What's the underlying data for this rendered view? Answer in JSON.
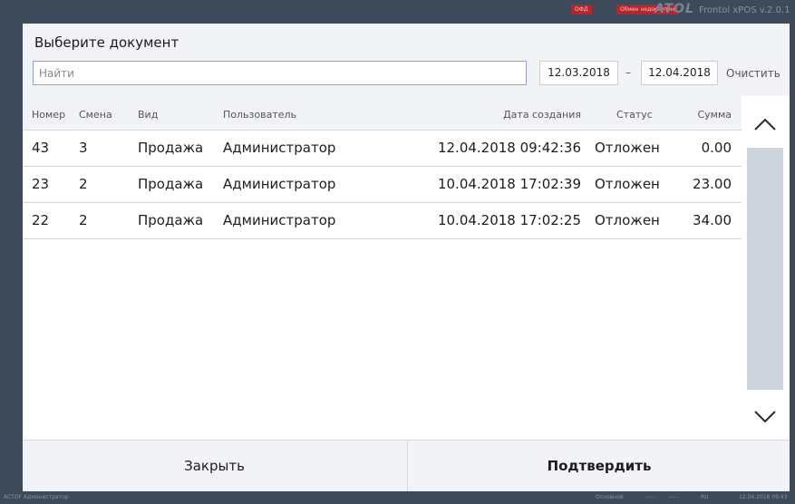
{
  "topbar": {
    "ofd_badge": "ОФД",
    "exchange_badge": "Обмен недоступен",
    "logo": "ATOL",
    "app_version": "Frontol xPOS v.2.0.1"
  },
  "dialog": {
    "title": "Выберите документ",
    "search_placeholder": "Найти",
    "date_from": "12.03.2018",
    "date_separator": "–",
    "date_to": "12.04.2018",
    "clear_label": "Очистить"
  },
  "table": {
    "columns": {
      "number": "Номер",
      "shift": "Смена",
      "type": "Вид",
      "user": "Пользователь",
      "created": "Дата создания",
      "status": "Статус",
      "sum": "Сумма"
    },
    "rows": [
      {
        "number": "43",
        "shift": "3",
        "type": "Продажа",
        "user": "Администратор",
        "created": "12.04.2018 09:42:36",
        "status": "Отложен",
        "sum": "0.00"
      },
      {
        "number": "23",
        "shift": "2",
        "type": "Продажа",
        "user": "Администратор",
        "created": "10.04.2018 17:02:39",
        "status": "Отложен",
        "sum": "23.00"
      },
      {
        "number": "22",
        "shift": "2",
        "type": "Продажа",
        "user": "Администратор",
        "created": "10.04.2018 17:02:25",
        "status": "Отложен",
        "sum": "34.00"
      }
    ]
  },
  "footer": {
    "close_label": "Закрыть",
    "confirm_label": "Подтвердить"
  },
  "statusbar": {
    "left": "ACTOF Администратор",
    "mode": "Основной",
    "dash1": "--:--",
    "dash2": "--:--",
    "lang": "RU",
    "datetime": "12.04.2018 09:43"
  },
  "icons": {
    "scroll_up": "chevron-up-icon",
    "scroll_down": "chevron-down-icon"
  },
  "colors": {
    "background": "#3d4a5a",
    "badge": "#b3262e",
    "search_border": "#8fa3cc",
    "scrollbar": "#cdd4de"
  }
}
